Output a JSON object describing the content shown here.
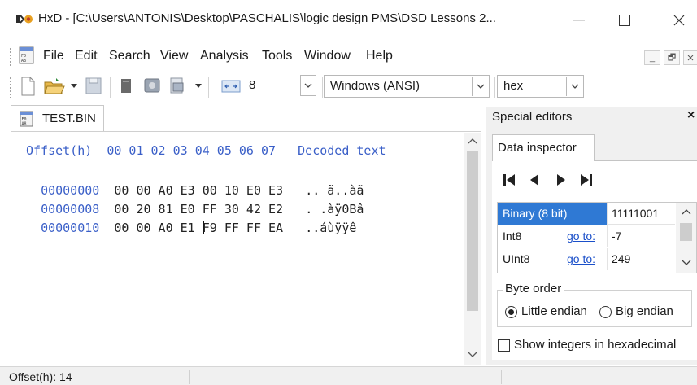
{
  "window": {
    "title": "HxD - [C:\\Users\\ANTONIS\\Desktop\\PASCHALIS\\logic design PMS\\DSD Lessons 2...",
    "icon": "hxd-app-icon",
    "controls": {
      "minimize": "—",
      "maximize": "☐",
      "close": "✕"
    }
  },
  "menu": {
    "items": [
      "File",
      "Edit",
      "Search",
      "View",
      "Analysis",
      "Tools",
      "Window",
      "Help"
    ],
    "mdi_minimize": "_",
    "mdi_restore": "🗗"
  },
  "toolbar": {
    "bytes_per_row": "8",
    "charset": "Windows (ANSI)",
    "offset_base": "hex"
  },
  "tab": {
    "label": "TEST.BIN"
  },
  "hex_editor": {
    "header": "Offset(h)  00 01 02 03 04 05 06 07   Decoded text",
    "rows": [
      {
        "offset": "00000000",
        "bytes": "00 00 A0 E3 00 10 E0 E3",
        "text": ".. ã..àã"
      },
      {
        "offset": "00000008",
        "bytes": "00 20 81 E0 FF 30 42 E2",
        "text": ". .àÿ0Bâ"
      },
      {
        "offset": "00000010",
        "bytes_before_caret": "00 00 A0 E1 ",
        "bytes_after_caret": "F9 FF FF EA",
        "text": "..áùÿÿê"
      }
    ]
  },
  "special_editors": {
    "title": "Special editors",
    "close": "×",
    "tab": "Data inspector",
    "nav": [
      "first",
      "previous",
      "next",
      "last"
    ],
    "grid": [
      {
        "name": "Binary (8 bit)",
        "link": "",
        "value": "11111001"
      },
      {
        "name": "Int8",
        "link": "go to:",
        "value": "-7"
      },
      {
        "name": "UInt8",
        "link": "go to:",
        "value": "249"
      }
    ],
    "byte_order": {
      "legend": "Byte order",
      "little": "Little endian",
      "big": "Big endian",
      "selected": "little"
    },
    "hex_integers_label": "Show integers in hexadecimal"
  },
  "status": {
    "offset": "Offset(h): 14"
  },
  "colors": {
    "offset_blue": "#3a5fc8",
    "selection_blue": "#2f79d4",
    "link_blue": "#1a4fc9"
  }
}
